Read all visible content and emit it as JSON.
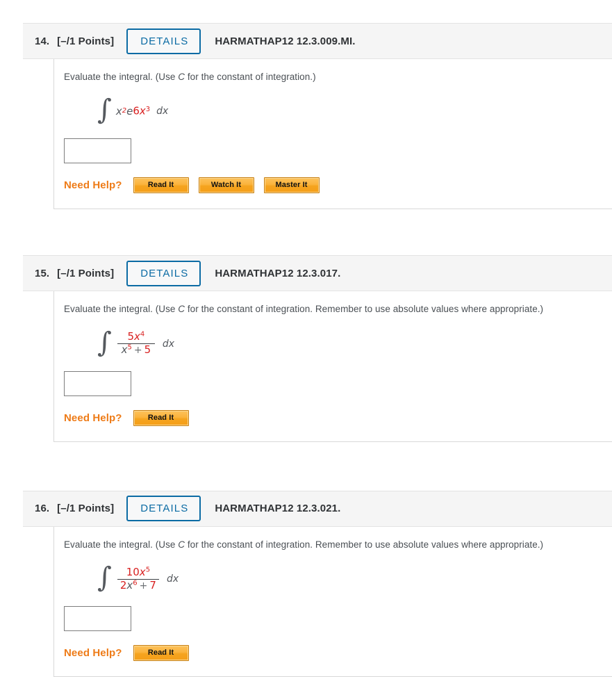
{
  "colors": {
    "accent_blue": "#0b6ba4",
    "help_orange": "#ee7b17",
    "math_red": "#d81f1f",
    "header_bg": "#f5f5f5",
    "text": "#3c4043"
  },
  "questions": [
    {
      "number": "14.",
      "points": "[–/1 Points]",
      "details_label": "DETAILS",
      "code": "HARMATHAP12 12.3.009.MI.",
      "prompt_pre": "Evaluate the integral. (Use ",
      "prompt_var": "C",
      "prompt_post": " for the constant of integration.)",
      "integral_sign": "∫",
      "expression_plain": "x^2 e^(6x^3) dx",
      "expr": {
        "kind": "product",
        "base_x": "x",
        "base_x_sup": "2",
        "e": "e",
        "e_exp_coef": "6",
        "e_exp_var": "x",
        "e_exp_sup": "3",
        "differential": "dx"
      },
      "answer_value": "",
      "answer_placeholder": "",
      "need_help_label": "Need Help?",
      "help_buttons": [
        "Read It",
        "Watch It",
        "Master It"
      ]
    },
    {
      "number": "15.",
      "points": "[–/1 Points]",
      "details_label": "DETAILS",
      "code": "HARMATHAP12 12.3.017.",
      "prompt_pre": "Evaluate the integral. (Use ",
      "prompt_var": "C",
      "prompt_post": " for the constant of integration. Remember to use absolute values where appropriate.)",
      "integral_sign": "∫",
      "expression_plain": "(5x^4)/(x^5 + 5) dx",
      "expr": {
        "kind": "fraction",
        "num_coef": "5",
        "num_var": "x",
        "num_sup": "4",
        "den_coef": "",
        "den_var": "x",
        "den_sup": "5",
        "den_op": "+",
        "den_const": "5",
        "differential": "dx"
      },
      "answer_value": "",
      "answer_placeholder": "",
      "need_help_label": "Need Help?",
      "help_buttons": [
        "Read It"
      ]
    },
    {
      "number": "16.",
      "points": "[–/1 Points]",
      "details_label": "DETAILS",
      "code": "HARMATHAP12 12.3.021.",
      "prompt_pre": "Evaluate the integral. (Use ",
      "prompt_var": "C",
      "prompt_post": " for the constant of integration. Remember to use absolute values where appropriate.)",
      "integral_sign": "∫",
      "expression_plain": "(10x^5)/(2x^6 + 7) dx",
      "expr": {
        "kind": "fraction",
        "num_coef": "10",
        "num_var": "x",
        "num_sup": "5",
        "den_coef": "2",
        "den_var": "x",
        "den_sup": "6",
        "den_op": "+",
        "den_const": "7",
        "differential": "dx"
      },
      "answer_value": "",
      "answer_placeholder": "",
      "need_help_label": "Need Help?",
      "help_buttons": [
        "Read It"
      ]
    }
  ]
}
